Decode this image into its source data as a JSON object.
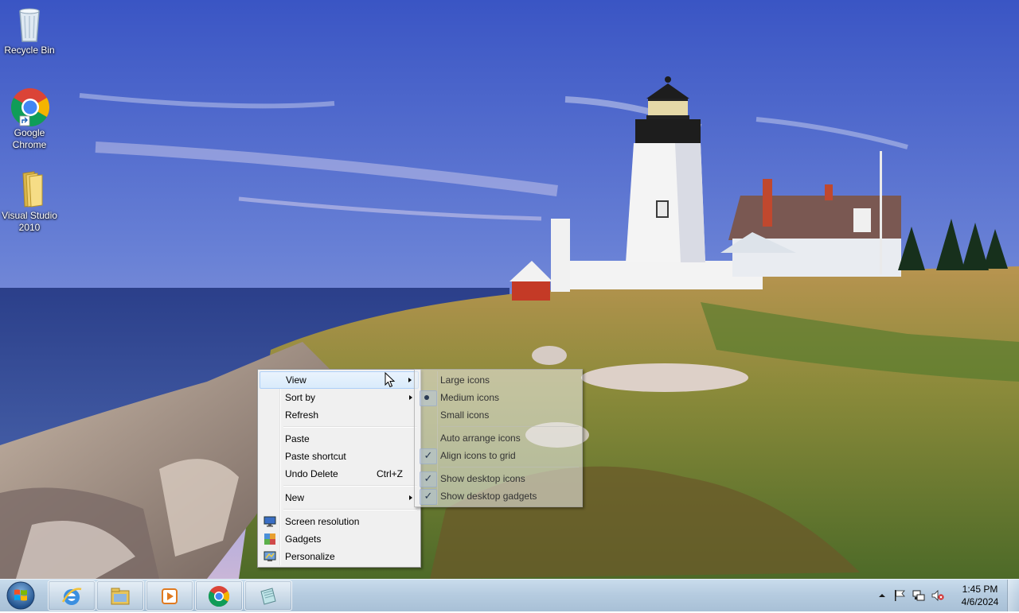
{
  "desktop": {
    "icons": [
      {
        "label": "Recycle Bin",
        "icon": "recycle-bin-icon"
      },
      {
        "label": "Google Chrome",
        "icon": "chrome-icon"
      },
      {
        "label": "Visual Studio 2010",
        "icon": "folder-icon"
      }
    ]
  },
  "context_menu": {
    "items": {
      "view": "View",
      "sort_by": "Sort by",
      "refresh": "Refresh",
      "paste": "Paste",
      "paste_shortcut": "Paste shortcut",
      "undo_delete": "Undo Delete",
      "undo_delete_shortcut": "Ctrl+Z",
      "new": "New",
      "screen_resolution": "Screen resolution",
      "gadgets": "Gadgets",
      "personalize": "Personalize"
    }
  },
  "view_submenu": {
    "large_icons": "Large icons",
    "medium_icons": "Medium icons",
    "small_icons": "Small icons",
    "auto_arrange": "Auto arrange icons",
    "align_to_grid": "Align icons to grid",
    "show_desktop_icons": "Show desktop icons",
    "show_desktop_gadgets": "Show desktop gadgets",
    "selected_size": "Medium icons",
    "checked": [
      "Align icons to grid",
      "Show desktop icons",
      "Show desktop gadgets"
    ]
  },
  "taskbar": {
    "pinned": [
      "internet-explorer-icon",
      "windows-explorer-icon",
      "media-player-icon",
      "chrome-icon",
      "notepad-icon"
    ],
    "tray_icons": [
      "show-hidden-icons-chevron",
      "action-center-flag-icon",
      "network-icon",
      "volume-muted-icon"
    ],
    "clock_time": "1:45 PM",
    "clock_date": "4/6/2024"
  },
  "colors": {
    "menu_highlight": "#d9ebfb",
    "taskbar": "#b6cce0"
  }
}
